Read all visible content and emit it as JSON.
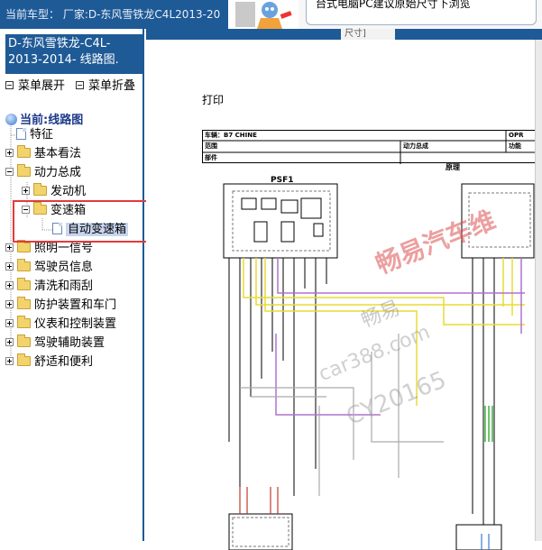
{
  "topbar": {
    "vehicle_label": "当前车型：  厂家:D-东风雪铁龙C4L2013-20",
    "banner_text": "台式电脑PC建议原始尺寸下浏览"
  },
  "sidebar": {
    "title": "D-东风雪铁龙-C4L-2013-2014- 线路图.",
    "expand_label": "菜单展开",
    "collapse_label": "菜单折叠",
    "current_label": "当前:线路图",
    "tree": [
      {
        "label": "特征",
        "type": "page"
      },
      {
        "label": "基本看法",
        "type": "folder",
        "expanded": false
      },
      {
        "label": "动力总成",
        "type": "folder",
        "expanded": true
      },
      {
        "label": "发动机",
        "type": "folder",
        "expanded": false
      },
      {
        "label": "变速箱",
        "type": "folder",
        "expanded": true
      },
      {
        "label": "自动变速箱",
        "type": "page",
        "selected": true
      },
      {
        "label": "照明一信号",
        "type": "folder",
        "expanded": false
      },
      {
        "label": "驾驶员信息",
        "type": "folder",
        "expanded": false
      },
      {
        "label": "清洗和雨刮",
        "type": "folder",
        "expanded": false
      },
      {
        "label": "防护装置和车门",
        "type": "folder",
        "expanded": false
      },
      {
        "label": "仪表和控制装置",
        "type": "folder",
        "expanded": false
      },
      {
        "label": "驾驶辅助装置",
        "type": "folder",
        "expanded": false
      },
      {
        "label": "舒适和便利",
        "type": "folder",
        "expanded": false
      }
    ]
  },
  "content": {
    "size_tab": "尺寸]",
    "print_label": "打印",
    "table": {
      "vehicle": "车辆：B7 CHINE",
      "opr": "OPR",
      "scope": "范围",
      "powertrain": "动力总成",
      "function": "功能",
      "component": "部件",
      "principle": "原理"
    },
    "psf1": "PSF1",
    "watermarks": [
      "畅易汽车维",
      "畅易",
      "car388.com",
      "CY20165"
    ]
  },
  "colors": {
    "accent": "#1e5a96",
    "highlight_box": "#e23b3b",
    "wire_yellow": "#f0e040",
    "wire_purple": "#b070d0",
    "wire_green": "#40b040"
  }
}
